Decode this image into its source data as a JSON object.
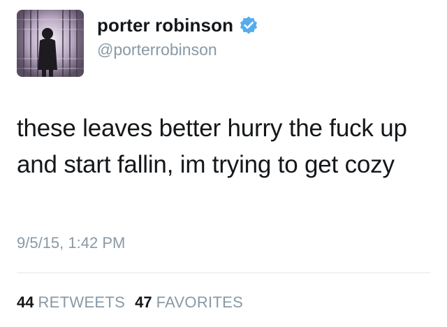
{
  "user": {
    "display_name": "porter robinson",
    "handle": "@porterrobinson",
    "verified": true,
    "verified_icon": "verified-badge-icon",
    "avatar_icon": "profile-photo",
    "verified_color": "#55acee"
  },
  "tweet": {
    "text": "these leaves better hurry the fuck up and start fallin, im trying to get cozy",
    "timestamp": "9/5/15, 1:42 PM"
  },
  "stats": {
    "retweets_count": "44",
    "retweets_label": "RETWEETS",
    "favorites_count": "47",
    "favorites_label": "FAVORITES"
  }
}
